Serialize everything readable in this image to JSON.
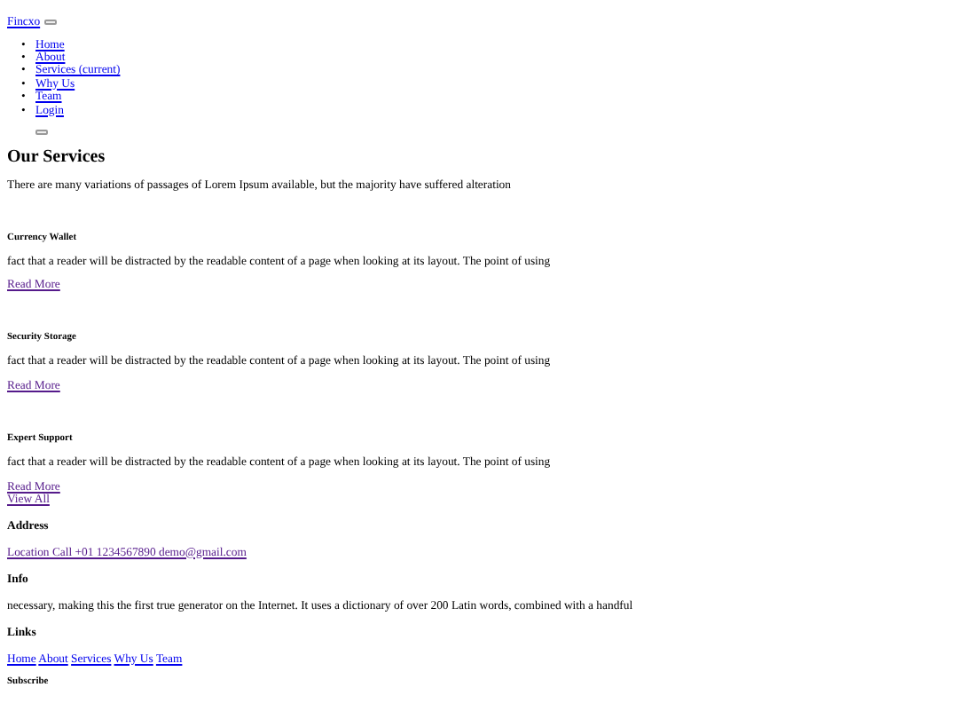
{
  "header": {
    "brand": {
      "text": "Fincxo",
      "visited": false
    },
    "nav_items": [
      {
        "marker": "•",
        "label": "Home",
        "visited": false
      },
      {
        "marker": "•",
        "label": "About",
        "visited": false
      },
      {
        "marker": "•",
        "label": "Services (current)",
        "visited": false
      },
      {
        "marker": "•",
        "label": "Why Us",
        "visited": false
      },
      {
        "marker": "•",
        "label": "Team",
        "visited": false
      },
      {
        "marker": "•",
        "label": "Login",
        "visited": false
      }
    ]
  },
  "services": {
    "title": "Our Services",
    "intro": "There are many variations of passages of Lorem Ipsum available, but the majority have suffered alteration",
    "items": [
      {
        "title": "Currency Wallet",
        "text": "fact that a reader will be distracted by the readable content of a page when looking at its layout. The point of using",
        "link": "Read More",
        "visited": true
      },
      {
        "title": "Security Storage",
        "text": "fact that a reader will be distracted by the readable content of a page when looking at its layout. The point of using",
        "link": "Read More",
        "visited": true
      },
      {
        "title": "Expert Support",
        "text": "fact that a reader will be distracted by the readable content of a page when looking at its layout. The point of using",
        "link": "Read More",
        "visited": true
      }
    ],
    "view_all": {
      "text": "View All",
      "visited": true
    }
  },
  "footer": {
    "address": {
      "title": "Address",
      "link": "Location Call +01 1234567890 demo@gmail.com",
      "visited": true
    },
    "info": {
      "title": "Info",
      "text": "necessary, making this the first true generator on the Internet. It uses a dictionary of over 200 Latin words, combined with a handful"
    },
    "links": {
      "title": "Links",
      "items": [
        {
          "label": "Home",
          "visited": false
        },
        {
          "label": "About",
          "visited": false
        },
        {
          "label": "Services",
          "visited": false
        },
        {
          "label": "Why Us",
          "visited": false
        },
        {
          "label": "Team",
          "visited": false
        }
      ]
    },
    "subscribe": {
      "title": "Subscribe"
    }
  }
}
